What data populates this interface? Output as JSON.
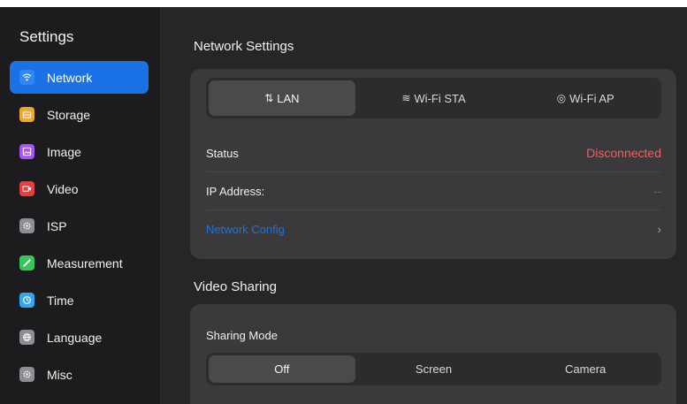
{
  "sidebar": {
    "title": "Settings",
    "items": [
      {
        "label": "Network",
        "icon": "wifi-icon",
        "color": "#1a72e6",
        "active": true
      },
      {
        "label": "Storage",
        "icon": "storage-icon",
        "color": "#f5a623"
      },
      {
        "label": "Image",
        "icon": "image-icon",
        "color": "#a855f7"
      },
      {
        "label": "Video",
        "icon": "video-icon",
        "color": "#ef3b3b"
      },
      {
        "label": "ISP",
        "icon": "isp-gear-icon",
        "color": "#8e8e93"
      },
      {
        "label": "Measurement",
        "icon": "ruler-icon",
        "color": "#34c759"
      },
      {
        "label": "Time",
        "icon": "clock-icon",
        "color": "#35a7f0"
      },
      {
        "label": "Language",
        "icon": "globe-icon",
        "color": "#8e8e93"
      },
      {
        "label": "Misc",
        "icon": "misc-gear-icon",
        "color": "#8e8e93"
      }
    ]
  },
  "network": {
    "section_title": "Network Settings",
    "tabs": [
      {
        "label": "LAN",
        "glyph": "⇅",
        "selected": true
      },
      {
        "label": "Wi-Fi STA",
        "glyph": "≋"
      },
      {
        "label": "Wi-Fi AP",
        "glyph": "◎"
      }
    ],
    "status_label": "Status",
    "status_value": "Disconnected",
    "ip_label": "IP Address:",
    "ip_value": "--",
    "config_label": "Network Config",
    "config_chevron": "›"
  },
  "video_sharing": {
    "section_title": "Video Sharing",
    "mode_label": "Sharing Mode",
    "modes": [
      {
        "label": "Off",
        "selected": true
      },
      {
        "label": "Screen"
      },
      {
        "label": "Camera"
      }
    ]
  },
  "colors": {
    "accent": "#1a72e6",
    "error": "#ff5a5f"
  }
}
